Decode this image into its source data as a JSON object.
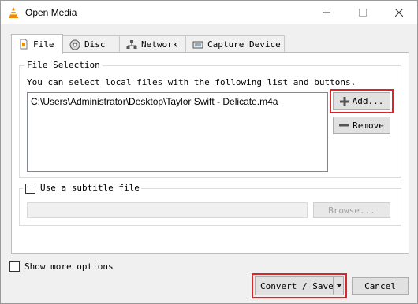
{
  "window": {
    "title": "Open Media",
    "minimize_icon": "minimize-icon",
    "maximize_icon": "maximize-icon",
    "close_icon": "close-icon"
  },
  "tabs": [
    {
      "label": "File",
      "icon": "file-icon",
      "active": true
    },
    {
      "label": "Disc",
      "icon": "disc-icon",
      "active": false
    },
    {
      "label": "Network",
      "icon": "network-icon",
      "active": false
    },
    {
      "label": "Capture Device",
      "icon": "capture-device-icon",
      "active": false
    }
  ],
  "file_selection": {
    "group_title": "File Selection",
    "instructions": "You can select local files with the following list and buttons.",
    "files": [
      "C:\\Users\\Administrator\\Desktop\\Taylor Swift - Delicate.m4a"
    ],
    "add_label": "Add...",
    "remove_label": "Remove"
  },
  "subtitle": {
    "checkbox_label": "Use a subtitle file",
    "checked": false,
    "path_value": "",
    "browse_label": "Browse..."
  },
  "footer": {
    "show_more_label": "Show more options",
    "show_more_checked": false,
    "convert_label": "Convert / Save",
    "cancel_label": "Cancel"
  },
  "colors": {
    "highlight": "#d9262b",
    "vlc_orange": "#f18a00"
  }
}
